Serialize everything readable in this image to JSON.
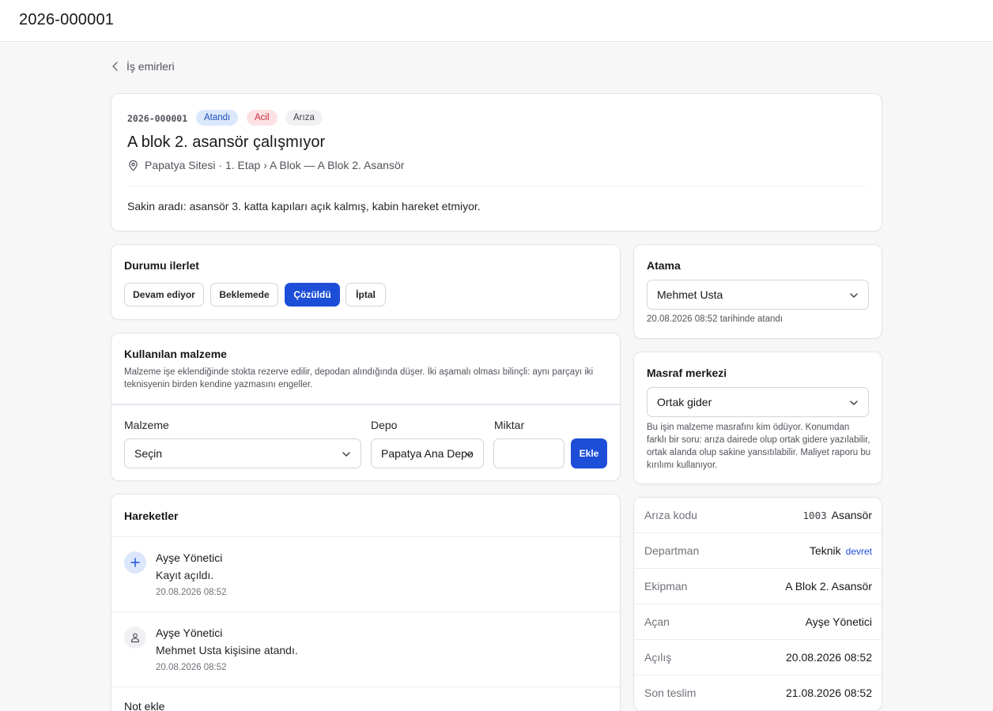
{
  "topbar": {
    "title": "2026-000001"
  },
  "back": {
    "label": "İş emirleri"
  },
  "work_order": {
    "code": "2026-000001",
    "badges": {
      "status": "Atandı",
      "priority": "Acil",
      "type": "Arıza"
    },
    "title": "A blok 2. asansör çalışmıyor",
    "location": "Papatya Sitesi · 1. Etap › A Blok — A Blok 2. Asansör",
    "description": "Sakin aradı: asansör 3. katta kapıları açık kalmış, kabin hareket etmiyor."
  },
  "status_panel": {
    "title": "Durumu ilerlet",
    "buttons": [
      "Devam ediyor",
      "Beklemede",
      "Çözüldü",
      "İptal"
    ],
    "active": "Çözüldü"
  },
  "materials": {
    "title": "Kullanılan malzeme",
    "description": "Malzeme işe eklendiğinde stokta rezerve edilir, depodan alındığında düşer. İki aşamalı olması bilinçli: aynı parçayı iki teknisyenin birden kendine yazmasını engeller.",
    "material_label": "Malzeme",
    "material_value": "Seçin",
    "depot_label": "Depo",
    "depot_value": "Papatya Ana Depo",
    "quantity_label": "Miktar",
    "quantity_value": "",
    "add_label": "Ekle"
  },
  "history": {
    "title": "Hareketler",
    "events": [
      {
        "actor": "Ayşe Yönetici",
        "text": "Kayıt açıldı.",
        "time": "20.08.2026 08:52",
        "icon": "plus-icon"
      },
      {
        "actor": "Ayşe Yönetici",
        "text": "Mehmet Usta kişisine atandı.",
        "time": "20.08.2026 08:52",
        "icon": "user-icon"
      }
    ],
    "note_label": "Not ekle"
  },
  "assignment": {
    "title": "Atama",
    "assignee": "Mehmet Usta",
    "meta": "20.08.2026 08:52 tarihinde atandı"
  },
  "cost_center": {
    "title": "Masraf merkezi",
    "value": "Ortak gider",
    "description": "Bu işin malzeme masrafını kim ödüyor. Konumdan farklı bir soru: arıza dairede olup ortak gidere yazılabilir, ortak alanda olup sakine yansıtılabilir. Maliyet raporu bu kırılımı kullanıyor."
  },
  "details": {
    "fault_code_label": "Arıza kodu",
    "fault_code": "1003",
    "fault_name": "Asansör",
    "department_label": "Departman",
    "department": "Teknik",
    "transfer_label": "devret",
    "equipment_label": "Ekipman",
    "equipment": "A Blok 2. Asansör",
    "opener_label": "Açan",
    "opener": "Ayşe Yönetici",
    "opened_label": "Açılış",
    "opened": "20.08.2026 08:52",
    "due_label": "Son teslim",
    "due": "21.08.2026 08:52"
  },
  "colors": {
    "primary": "#1d4ed8",
    "badge_assigned": "#dbe7fb",
    "badge_urgent": "#fde2e4"
  }
}
